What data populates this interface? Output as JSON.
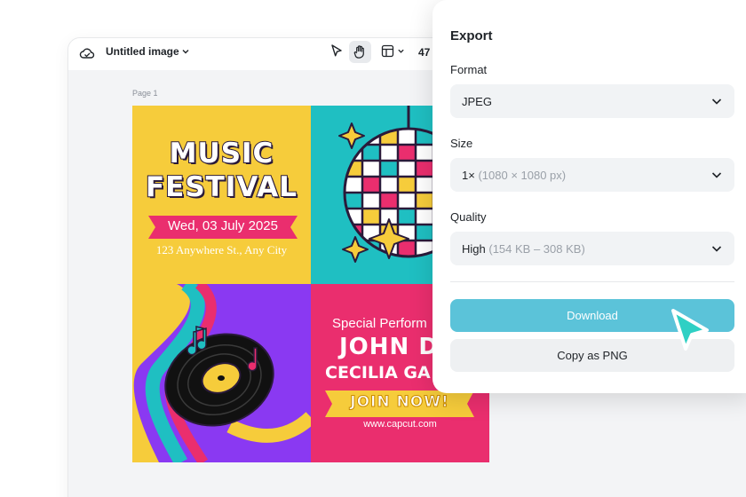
{
  "topbar": {
    "icons": [
      "cloud-icon",
      "chevron-down-icon",
      "pointer-icon",
      "hand-icon",
      "layout-icon",
      "chevron-down-icon"
    ],
    "title": "Untitled image",
    "zoom": "47"
  },
  "canvas": {
    "page_label": "Page 1",
    "poster": {
      "title_line1": "MUSIC",
      "title_line2": "FESTIVAL",
      "date": "Wed, 03 July 2025",
      "address": "123 Anywhere St., Any City",
      "special": "Special Perform",
      "artist1": "JOHN DO",
      "artist2": "CECILIA GA",
      "cta": "JOIN NOW!",
      "url": "www.capcut.com",
      "colors": {
        "yellow": "#f6cc3b",
        "teal": "#1fbfc2",
        "purple": "#8a39f2",
        "pink": "#ea2e6e"
      }
    }
  },
  "export": {
    "title": "Export",
    "format": {
      "label": "Format",
      "value": "JPEG"
    },
    "size": {
      "label": "Size",
      "value": "1×",
      "detail": "(1080 × 1080 px)"
    },
    "quality": {
      "label": "Quality",
      "value": "High",
      "detail": "(154 KB – 308 KB)"
    },
    "download_label": "Download",
    "copy_label": "Copy as PNG",
    "accent": "#5bc3d9"
  }
}
